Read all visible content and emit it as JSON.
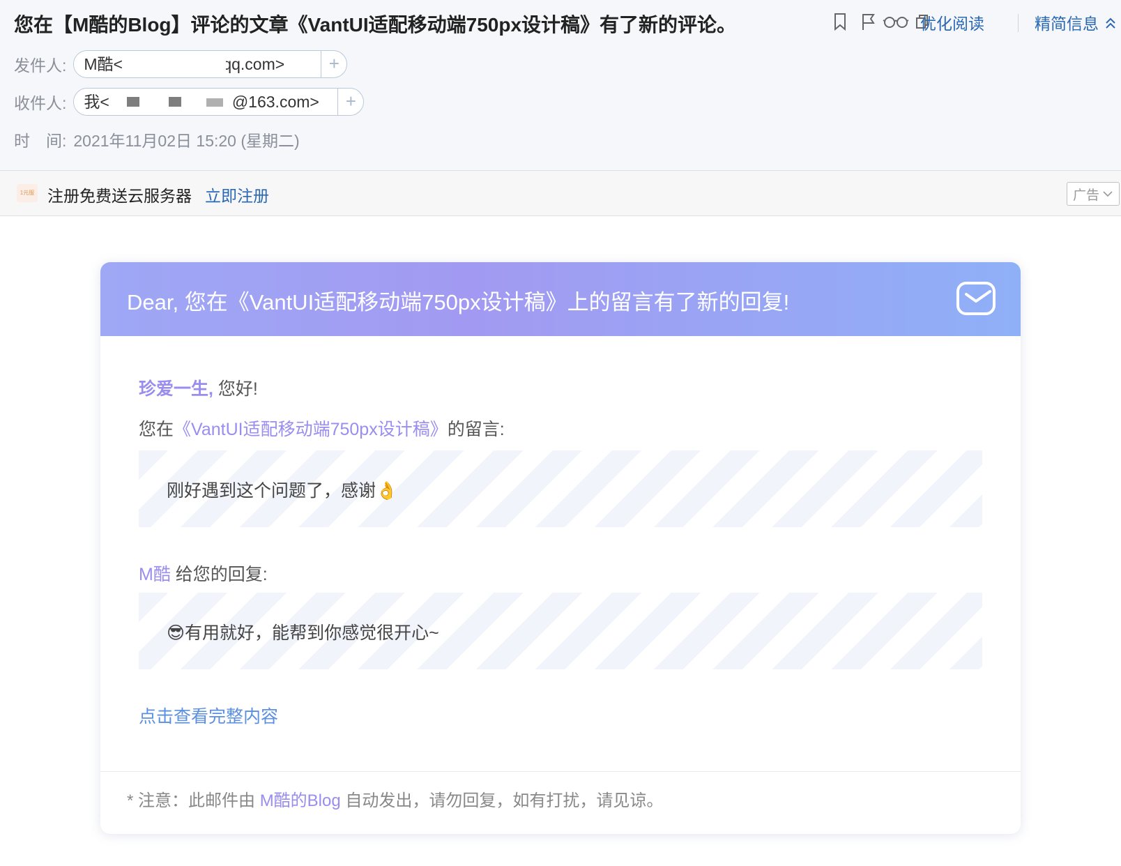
{
  "header": {
    "subject": "您在【M酷的Blog】评论的文章《VantUI适配移动端750px设计稿》有了新的评论。",
    "optimize_read": "优化阅读",
    "compact_info": "精简信息",
    "from_label": "发件人:",
    "from_name": "M酷<",
    "from_tail": "@qq.com>",
    "to_label": "收件人:",
    "to_name": "我<",
    "to_tail": "@163.com>",
    "time_label": "时　间:",
    "time_value": "2021年11月02日 15:20 (星期二)",
    "add_symbol": "+"
  },
  "ad": {
    "logo_text": "1元服",
    "text": "注册免费送云服务器",
    "link": "立即注册",
    "badge": "广告"
  },
  "card": {
    "title": "Dear, 您在《VantUI适配移动端750px设计稿》上的留言有了新的回复!",
    "user_name": "珍爱一生,",
    "greeting": " 您好!",
    "comment_prefix": "您在",
    "article_title": "《VantUI适配移动端750px设计稿》",
    "comment_suffix": "的留言:",
    "comment_text": "刚好遇到这个问题了，感谢👌",
    "replier": "M酷",
    "reply_suffix": " 给您的回复:",
    "reply_text": "😎有用就好，能帮到你感觉很开心~",
    "view_full": "点击查看完整内容",
    "footer_prefix": "* 注意：此邮件由 ",
    "footer_blog": "M酷的Blog",
    "footer_suffix": " 自动发出，请勿回复，如有打扰，请见谅。"
  },
  "colors": {
    "accent_purple": "#9a8df0",
    "link_blue": "#2a68b3",
    "header_gradient_start": "#9ea8f5",
    "header_gradient_end": "#8fb0f7"
  },
  "icons": [
    "bookmark-icon",
    "flag-icon",
    "glasses-icon",
    "copy-icon",
    "chevron-up-icon",
    "mail-icon",
    "chevron-down-icon"
  ]
}
